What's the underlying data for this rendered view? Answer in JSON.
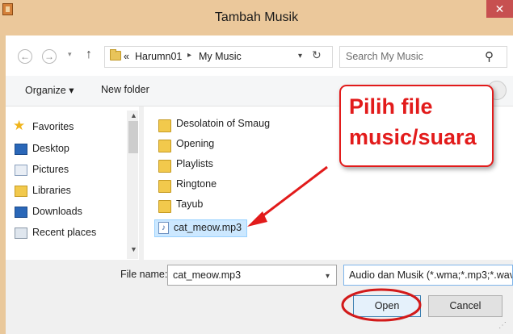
{
  "window": {
    "title": "Tambah Musik",
    "close_label": "✕"
  },
  "navigation": {
    "back_glyph": "←",
    "forward_glyph": "→",
    "up_glyph": "↑",
    "breadcrumb_overflow": "«",
    "breadcrumb": [
      "Harumn01",
      "My Music"
    ],
    "separator": "▸",
    "refresh_glyph": "↻",
    "search_placeholder": "Search My Music",
    "search_glyph": "⚲"
  },
  "toolbar": {
    "organize_label": "Organize ▾",
    "new_folder_label": "New folder"
  },
  "nav_pane": {
    "items": [
      {
        "label": "Favorites",
        "icon": "star-icon"
      },
      {
        "label": "Desktop",
        "icon": "desktop-icon"
      },
      {
        "label": "Pictures",
        "icon": "pictures-icon"
      },
      {
        "label": "Libraries",
        "icon": "libraries-icon"
      },
      {
        "label": "Downloads",
        "icon": "downloads-icon"
      },
      {
        "label": "Recent places",
        "icon": "recent-places-icon"
      }
    ]
  },
  "files": {
    "folders": [
      "Desolatoin of Smaug",
      "Opening",
      "Playlists",
      "Ringtone",
      "Tayub"
    ],
    "selected_file": "cat_meow.mp3"
  },
  "bottom": {
    "file_name_label": "File name:",
    "file_name_value": "cat_meow.mp3",
    "file_type_value": "Audio dan Musik (*.wma;*.mp3;*.wav",
    "open_label": "Open",
    "cancel_label": "Cancel"
  },
  "annotation": {
    "callout_line1": "Pilih file",
    "callout_line2": "music/suara",
    "accent_color": "#e21b1b"
  },
  "colors": {
    "title_bar": "#ebc89b",
    "selection": "#cce8ff",
    "close": "#c75050"
  }
}
